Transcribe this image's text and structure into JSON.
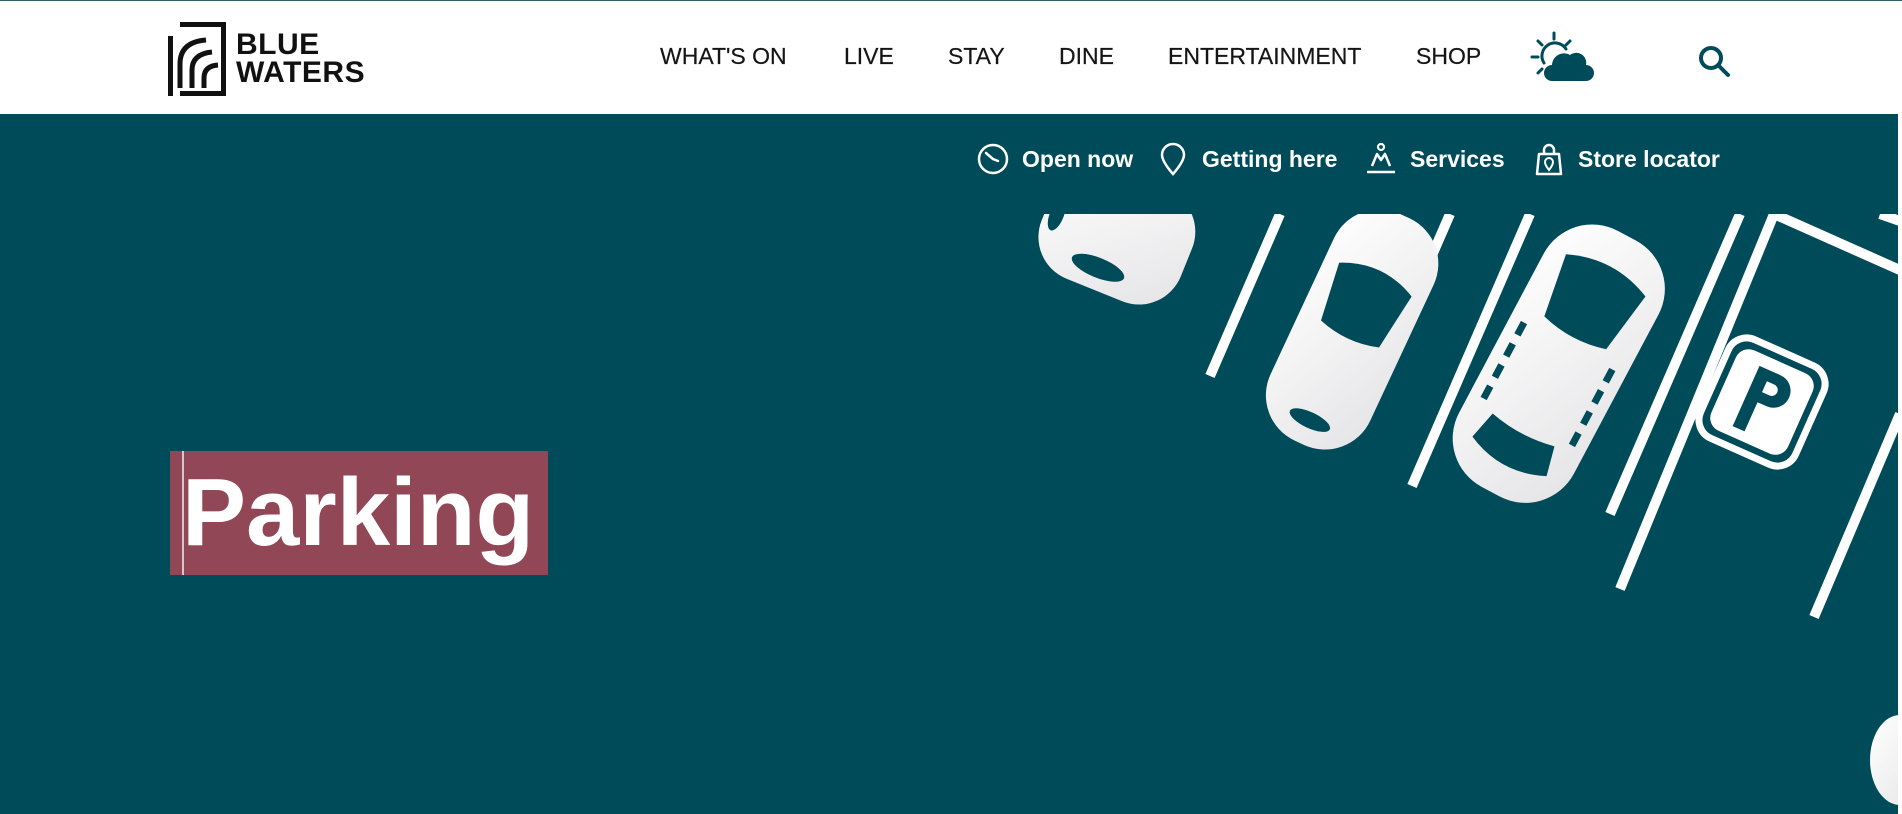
{
  "brand": {
    "name_line1": "BLUE",
    "name_line2": "WATERS",
    "accent_color": "#004b5a",
    "highlight_color": "#914756"
  },
  "nav": {
    "items": [
      {
        "label": "WHAT'S ON"
      },
      {
        "label": "LIVE"
      },
      {
        "label": "STAY"
      },
      {
        "label": "DINE"
      },
      {
        "label": "ENTERTAINMENT"
      },
      {
        "label": "SHOP"
      }
    ],
    "weather_icon": "sun-cloud-icon",
    "search_icon": "search-icon"
  },
  "utility_nav": {
    "items": [
      {
        "label": "Open now",
        "icon": "clock-icon"
      },
      {
        "label": "Getting here",
        "icon": "map-pin-icon"
      },
      {
        "label": "Services",
        "icon": "services-icon"
      },
      {
        "label": "Store locator",
        "icon": "shopping-bag-icon"
      }
    ]
  },
  "hero": {
    "title": "Parking",
    "illustration": "parking-lot-illustration"
  }
}
